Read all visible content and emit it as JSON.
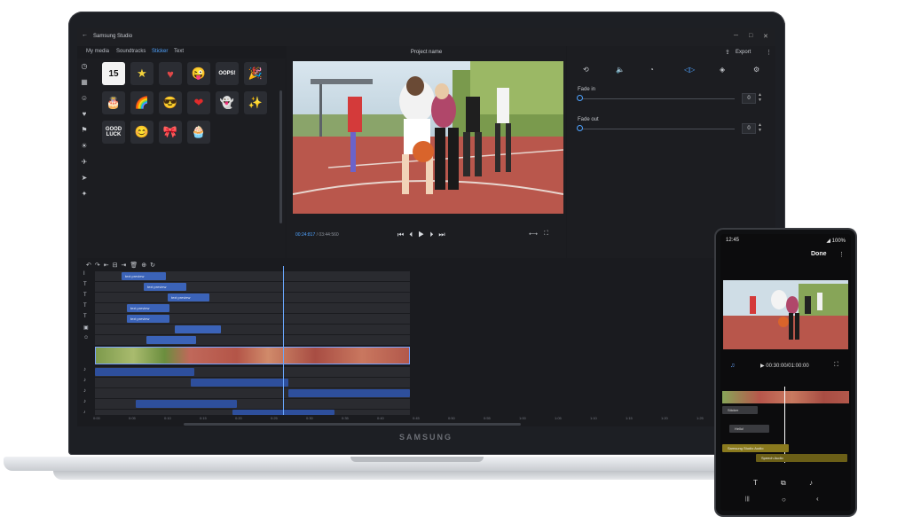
{
  "window": {
    "title": "Samsung Studio",
    "back_icon": "back-arrow-icon",
    "controls": [
      "─",
      "□",
      "✕"
    ]
  },
  "tabs": [
    {
      "label": "My media",
      "active": false
    },
    {
      "label": "Soundtracks",
      "active": false
    },
    {
      "label": "Sticker",
      "active": true
    },
    {
      "label": "Text",
      "active": false
    }
  ],
  "sticker_categories": [
    "clock-icon",
    "calendar-icon",
    "smiley-icon",
    "heart-icon",
    "flag-icon",
    "sun-icon",
    "plane-icon",
    "bird-icon",
    "party-icon"
  ],
  "stickers": [
    {
      "glyph": "15",
      "icon": "calendar-15-sticker"
    },
    {
      "glyph": "★",
      "icon": "star-sticker"
    },
    {
      "glyph": "♥",
      "icon": "heart-face-sticker"
    },
    {
      "glyph": "😜",
      "icon": "wink-emoji-sticker"
    },
    {
      "glyph": "OOPS!",
      "icon": "oops-text-sticker"
    },
    {
      "glyph": "🎉",
      "icon": "party-popper-sticker"
    },
    {
      "glyph": "🎂",
      "icon": "cake-sticker"
    },
    {
      "glyph": "🌈",
      "icon": "rainbow-sticker"
    },
    {
      "glyph": "😎",
      "icon": "sunglasses-emoji-sticker"
    },
    {
      "glyph": "❤",
      "icon": "red-heart-sticker"
    },
    {
      "glyph": "👻",
      "icon": "ghost-sticker"
    },
    {
      "glyph": "✨",
      "icon": "sparkle-sticker"
    },
    {
      "glyph": "GOOD LUCK",
      "icon": "good-luck-text-sticker"
    },
    {
      "glyph": "😊",
      "icon": "smile-emoji-sticker"
    },
    {
      "glyph": "🎀",
      "icon": "ribbon-sticker"
    },
    {
      "glyph": "🧁",
      "icon": "cupcake-sticker"
    }
  ],
  "preview": {
    "project_name": "Project name",
    "current_time": "00:24:817",
    "total_time": "/ 03:44:560",
    "transport": [
      "⏮",
      "⏴",
      "▶",
      "⏵",
      "⏭"
    ]
  },
  "right_panel": {
    "export_label": "Export",
    "tool_icons": [
      "rotate-icon",
      "volume-icon",
      "speed-icon",
      "fade-icon",
      "color-icon",
      "settings-icon"
    ],
    "fade_in_label": "Fade in",
    "fade_in_value": "0",
    "fade_out_label": "Fade out",
    "fade_out_value": "0"
  },
  "timeline": {
    "tools": [
      "↶",
      "↷",
      "⇤",
      "⊟",
      "⇥",
      "🗑",
      "⊕",
      "↻"
    ],
    "text_clips": [
      {
        "label": "text preview"
      },
      {
        "label": "text preview"
      },
      {
        "label": "text preview"
      },
      {
        "label": "text preview"
      },
      {
        "label": "text preview"
      }
    ],
    "ruler": [
      "0:00",
      "0:05",
      "0:10",
      "0:15",
      "0:20",
      "0:25",
      "0:30",
      "0:35",
      "0:40",
      "0:45",
      "0:50",
      "0:55",
      "1:00",
      "1:05",
      "1:10",
      "1:15",
      "1:20",
      "1:25",
      "1:30"
    ]
  },
  "phone": {
    "time": "12:45",
    "status": "◢ 100%",
    "done_label": "Done",
    "playback": "00:30:00/01:00:00",
    "sticker_clip": "Sticker",
    "text_clip": "Hello!",
    "audio_clip": "Samsung Studio Audio",
    "speech_clip": "Speech Audio",
    "tools": [
      "T",
      "⧉",
      "♪"
    ],
    "nav": [
      "|||",
      "○",
      "‹"
    ]
  },
  "laptop_brand": "SAMSUNG",
  "colors": {
    "accent": "#4fa3ff",
    "clip": "#3b63b8",
    "phone_audio": "#8a7a1e"
  }
}
